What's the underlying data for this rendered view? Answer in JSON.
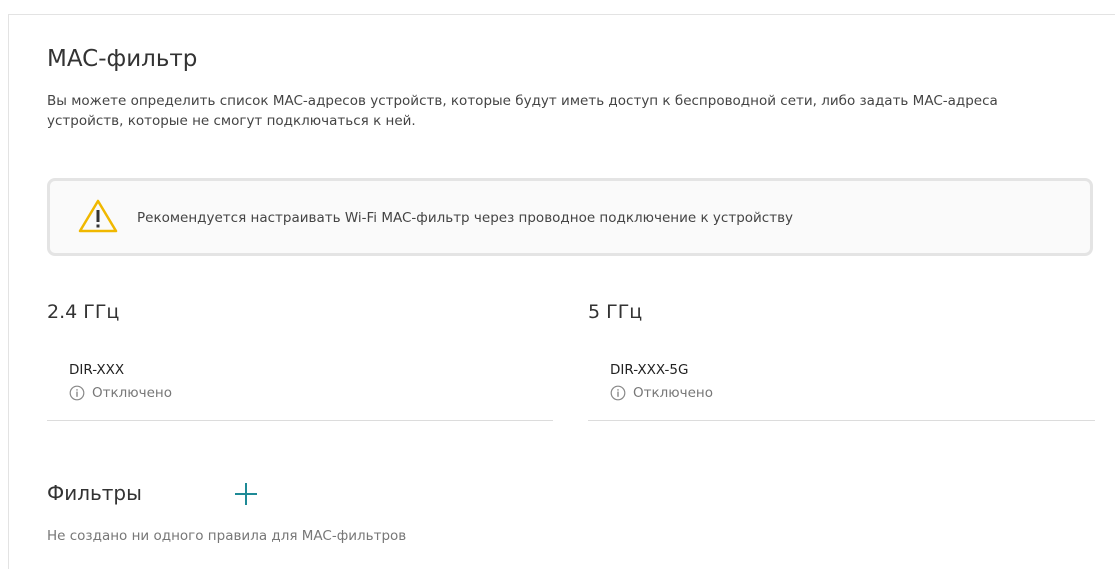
{
  "page": {
    "title": "MAC-фильтр",
    "description": "Вы можете определить список MAC-адресов устройств, которые будут иметь доступ к беспроводной сети, либо задать MAC-адреса устройств, которые не смогут подключаться к ней."
  },
  "warning": {
    "icon": "warning-triangle-icon",
    "text": "Рекомендуется настраивать Wi-Fi MAC-фильтр через проводное подключение к устройству",
    "icon_color": "#f0b800"
  },
  "bands": [
    {
      "title": "2.4 ГГц",
      "network_name": "DIR-XXX",
      "status": "Отключено",
      "status_icon": "info-icon"
    },
    {
      "title": "5 ГГц",
      "network_name": "DIR-XXX-5G",
      "status": "Отключено",
      "status_icon": "info-icon"
    }
  ],
  "filters": {
    "title": "Фильтры",
    "add_icon": "plus-icon",
    "add_color": "#1e8a96",
    "empty_text": "Не создано ни одного правила для MAC-фильтров"
  }
}
